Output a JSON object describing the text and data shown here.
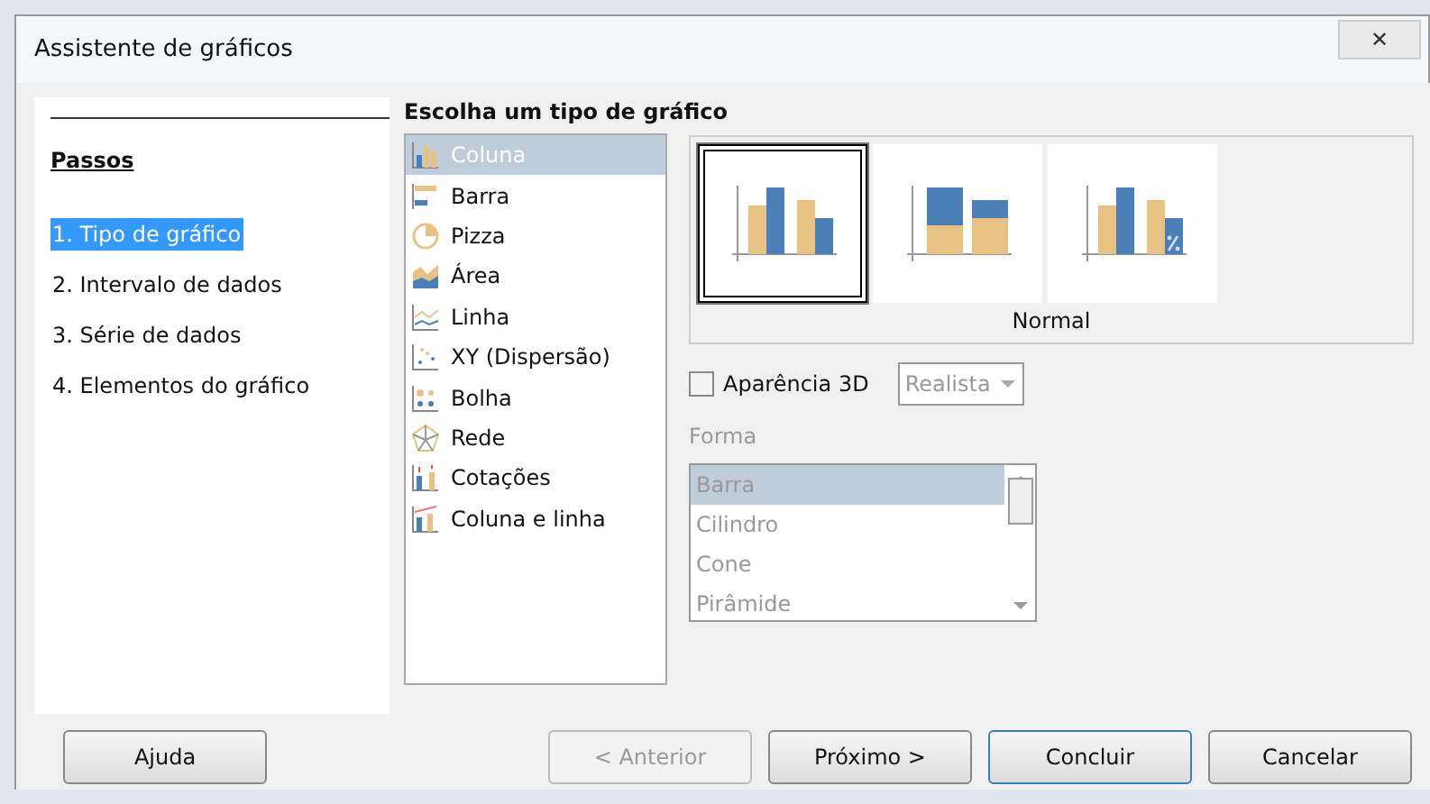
{
  "window": {
    "title": "Assistente de gráficos",
    "close": "✕"
  },
  "steps": {
    "heading": "Passos",
    "items": [
      {
        "label": "1. Tipo de gráfico",
        "selected": true
      },
      {
        "label": "2. Intervalo de dados",
        "selected": false
      },
      {
        "label": "3. Série de dados",
        "selected": false
      },
      {
        "label": "4. Elementos do gráfico",
        "selected": false
      }
    ]
  },
  "chart_type": {
    "heading": "Escolha um tipo de gráfico",
    "types": [
      {
        "label": "Coluna",
        "kind": "column",
        "selected": true
      },
      {
        "label": "Barra",
        "kind": "bar",
        "selected": false
      },
      {
        "label": "Pizza",
        "kind": "pie",
        "selected": false
      },
      {
        "label": "Área",
        "kind": "area",
        "selected": false
      },
      {
        "label": "Linha",
        "kind": "line",
        "selected": false
      },
      {
        "label": "XY (Dispersão)",
        "kind": "xy",
        "selected": false
      },
      {
        "label": "Bolha",
        "kind": "bubble",
        "selected": false
      },
      {
        "label": "Rede",
        "kind": "net",
        "selected": false
      },
      {
        "label": "Cotações",
        "kind": "stock",
        "selected": false
      },
      {
        "label": "Coluna e linha",
        "kind": "combo",
        "selected": false
      }
    ],
    "variants": [
      {
        "kind": "normal",
        "selected": true
      },
      {
        "kind": "stacked",
        "selected": false
      },
      {
        "kind": "percent",
        "selected": false
      }
    ],
    "variant_name": "Normal"
  },
  "appearance_3d": {
    "label": "Aparência 3D",
    "checked": false,
    "scheme": "Realista",
    "disabled": true
  },
  "shape": {
    "label": "Forma",
    "disabled": true,
    "items": [
      {
        "label": "Barra",
        "selected": true
      },
      {
        "label": "Cilindro",
        "selected": false
      },
      {
        "label": "Cone",
        "selected": false
      },
      {
        "label": "Pirâmide",
        "selected": false
      }
    ]
  },
  "buttons": [
    {
      "label": "Ajuda",
      "disabled": false,
      "default": false
    },
    {
      "label": "< Anterior",
      "disabled": true,
      "default": false
    },
    {
      "label": "Próximo >",
      "disabled": false,
      "default": false
    },
    {
      "label": "Concluir",
      "disabled": false,
      "default": true
    },
    {
      "label": "Cancelar",
      "disabled": false,
      "default": false
    }
  ]
}
